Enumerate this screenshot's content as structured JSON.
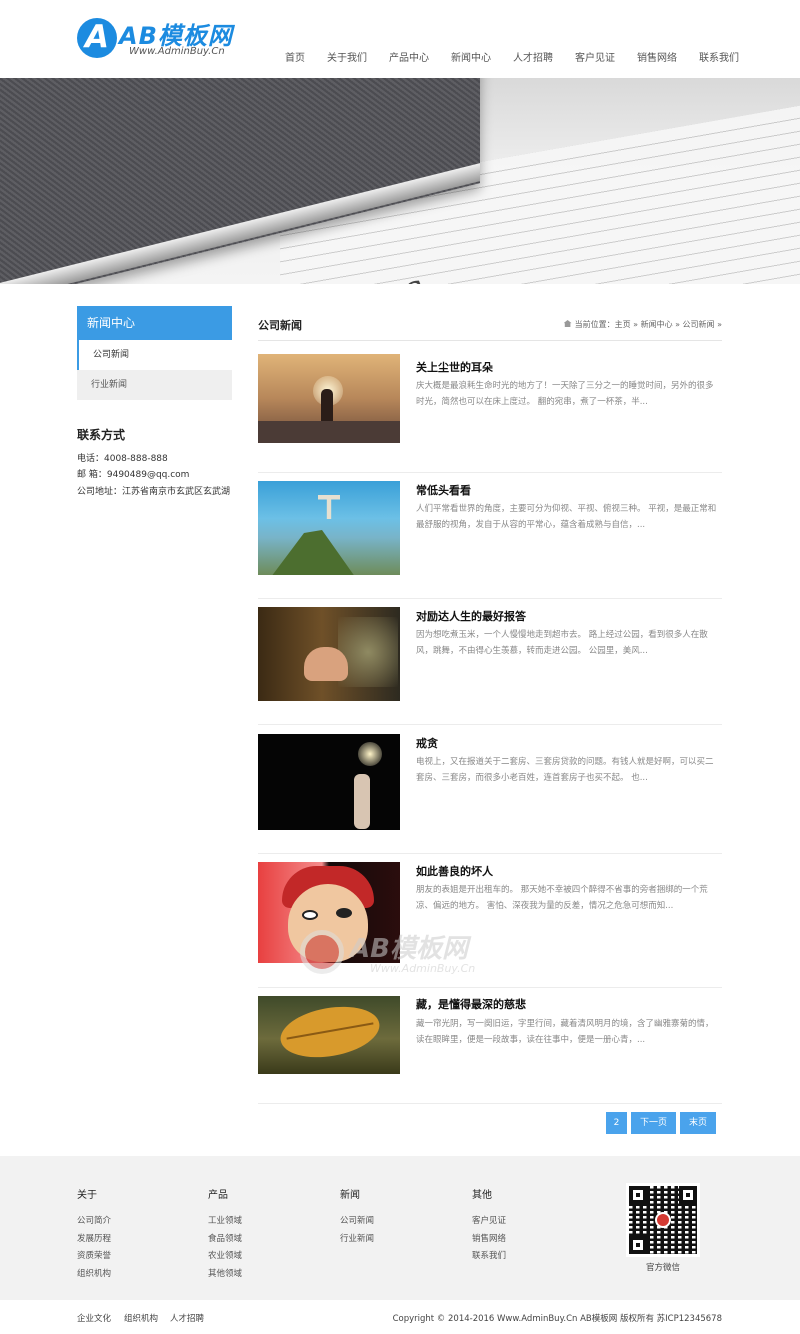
{
  "brand": {
    "title": "AB模板网",
    "subtitle": "Www.AdminBuy.Cn",
    "accent": "#1c8be0"
  },
  "nav": [
    "首页",
    "关于我们",
    "产品中心",
    "新闻中心",
    "人才招聘",
    "客户见证",
    "销售网络",
    "联系我们"
  ],
  "banner": {
    "word": "News"
  },
  "sidebar": {
    "title": "新闻中心",
    "items": [
      "公司新闻",
      "行业新闻"
    ],
    "contact_title": "联系方式",
    "contact": [
      "电话：4008-888-888",
      "邮 箱：9490489@qq.com",
      "公司地址：江苏省南京市玄武区玄武湖"
    ]
  },
  "main": {
    "title": "公司新闻",
    "breadcrumb": "当前位置：主页 » 新闻中心 » 公司新闻 »"
  },
  "articles": [
    {
      "title": "关上尘世的耳朵",
      "desc": "庆大概是最浪耗生命时光的地方了！一天除了三分之一的睡觉时间，另外的很多时光，简然也可以在床上度过。 翻的宛串，煮了一杯茶，半..."
    },
    {
      "title": "常低头看看",
      "desc": "人们平常看世界的角度，主要可分为仰视、平视、俯视三种。 平视，是最正常和最舒服的视角，发自于从容的平常心，蕴含着成熟与自信，..."
    },
    {
      "title": "对励达人生的最好报答",
      "desc": "因为想吃煮玉米，一个人慢慢地走到超市去。 路上经过公园，看到很多人在散风，跳舞，不由得心生羡慕，转而走进公园。 公园里，美风..."
    },
    {
      "title": "戒贪",
      "desc": "电视上，又在报道关于二套房、三套房贷款的问题。有钱人就是好啊，可以买二套房、三套房，而很多小老百姓，连首套房子也买不起。 也..."
    },
    {
      "title": "如此善良的坏人",
      "desc": "朋友的表姐是开出租车的。 那天她不幸被四个醉得不省事的旁者捆绑的一个荒凉、偏远的地方。 害怕、深夜我为量的反差，情况之危急可想而知..."
    },
    {
      "title": "藏，是懂得最深的慈悲",
      "desc": "藏一帘光阴，写一阕旧运，字里行间，藏着清风明月的境，含了幽雅寨菊的情，读在眼眸里，便是一段故事，读在往事中，便是一册心青，..."
    }
  ],
  "pager": [
    "2",
    "下一页",
    "末页"
  ],
  "watermark": {
    "title": "AB模板网",
    "subtitle": "Www.AdminBuy.Cn"
  },
  "footer": {
    "columns": [
      {
        "title": "关于",
        "links": [
          "公司简介",
          "发展历程",
          "资质荣誉",
          "组织机构"
        ]
      },
      {
        "title": "产品",
        "links": [
          "工业领域",
          "食品领域",
          "农业领域",
          "其他领域"
        ]
      },
      {
        "title": "新闻",
        "links": [
          "公司新闻",
          "行业新闻"
        ]
      },
      {
        "title": "其他",
        "links": [
          "客户见证",
          "销售网络",
          "联系我们"
        ]
      }
    ],
    "qr_label": "官方微信",
    "bottom_links": [
      "企业文化",
      "组织机构",
      "人才招聘"
    ],
    "copyright": "Copyright © 2014-2016 Www.AdminBuy.Cn AB模板网 版权所有   苏ICP12345678"
  }
}
